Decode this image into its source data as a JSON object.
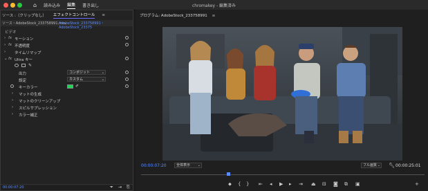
{
  "app": {
    "title": "chromakey - 編集済み",
    "nav": [
      {
        "label": "読み込み"
      },
      {
        "label": "編集",
        "active": true
      },
      {
        "label": "書き出し"
      }
    ]
  },
  "colors": {
    "traffic_red": "#ff5f57",
    "traffic_yellow": "#febc2e",
    "traffic_green": "#28c840",
    "timecode_blue": "#5b8cff",
    "key_color": "#22d35a"
  },
  "left_panel": {
    "tabs": [
      {
        "label": "ソース :（クリップなし）"
      },
      {
        "label": "エフェクトコントロール",
        "active": true
      }
    ],
    "source_label": "ソース・AdobeStock_233758991.mov",
    "sequence_label": "AdobeStock_233758991・AdobeStock_23375",
    "section_video": "ビデオ",
    "fx_rows": [
      {
        "label": "モーション"
      },
      {
        "label": "不透明度"
      },
      {
        "label": "タイムリマップ"
      }
    ],
    "ultra_key": {
      "label": "Ultra キー",
      "output_label": "出力",
      "output_value": "コンポジット",
      "setting_label": "設定",
      "setting_value": "カスタム",
      "key_color_label": "キーカラー",
      "subsections": [
        {
          "label": "マットの生成"
        },
        {
          "label": "マットのクリーンアップ"
        },
        {
          "label": "スピルサプレッション"
        },
        {
          "label": "カラー補正"
        }
      ]
    },
    "bottom_timecode": "00:00:07:20"
  },
  "program": {
    "title": "プログラム: AdobeStock_233758991",
    "current_timecode": "00:00:07:20",
    "zoom": "全体表示",
    "quality": "フル画質",
    "duration": "00:00:25:01"
  }
}
